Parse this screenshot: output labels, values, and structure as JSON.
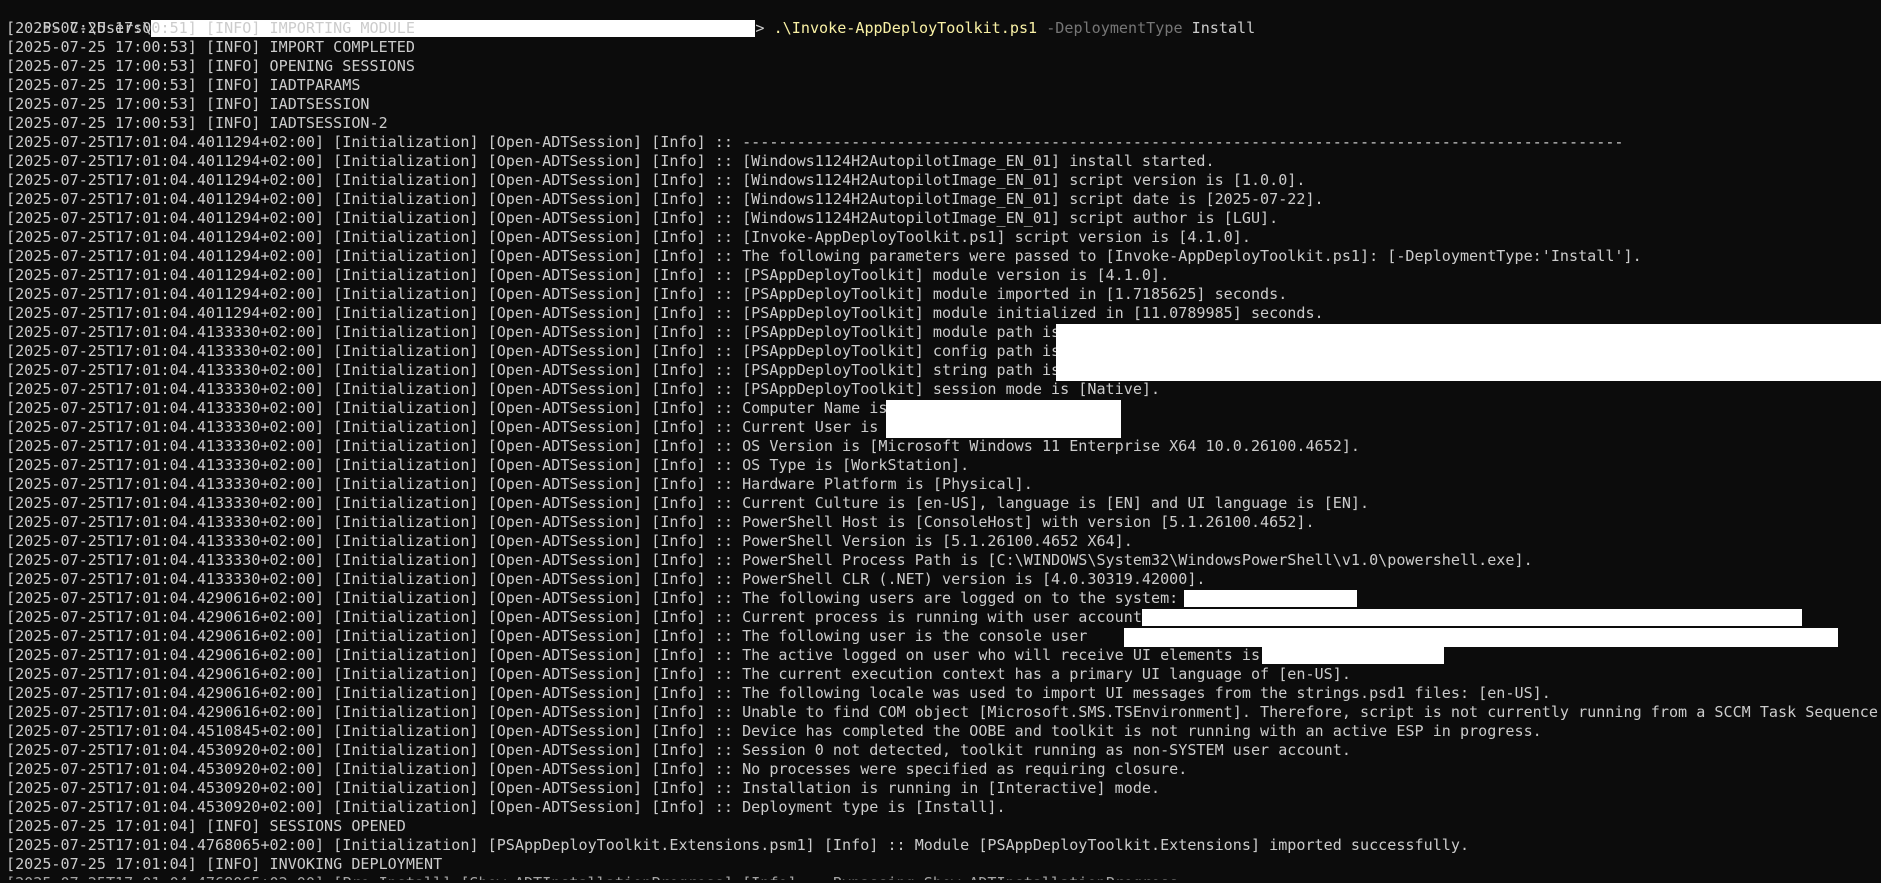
{
  "prompt": {
    "prefix": "PS C:\\Users\\",
    "suffix": "> ",
    "command": ".\\Invoke-AppDeployToolkit.ps1",
    "param": "-DeploymentType",
    "arg": "Install"
  },
  "lines": [
    "[2025-07-25 17:00:51] [INFO] IMPORTING MODULE",
    "[2025-07-25 17:00:53] [INFO] IMPORT COMPLETED",
    "[2025-07-25 17:00:53] [INFO] OPENING SESSIONS",
    "[2025-07-25 17:00:53] [INFO] IADTPARAMS",
    "[2025-07-25 17:00:53] [INFO] IADTSESSION",
    "[2025-07-25 17:00:53] [INFO] IADTSESSION-2",
    "[2025-07-25T17:01:04.4011294+02:00] [Initialization] [Open-ADTSession] [Info] :: -------------------------------------------------------------------------------------------------",
    "[2025-07-25T17:01:04.4011294+02:00] [Initialization] [Open-ADTSession] [Info] :: [Windows1124H2AutopilotImage_EN_01] install started.",
    "[2025-07-25T17:01:04.4011294+02:00] [Initialization] [Open-ADTSession] [Info] :: [Windows1124H2AutopilotImage_EN_01] script version is [1.0.0].",
    "[2025-07-25T17:01:04.4011294+02:00] [Initialization] [Open-ADTSession] [Info] :: [Windows1124H2AutopilotImage_EN_01] script date is [2025-07-22].",
    "[2025-07-25T17:01:04.4011294+02:00] [Initialization] [Open-ADTSession] [Info] :: [Windows1124H2AutopilotImage_EN_01] script author is [LGU].",
    "[2025-07-25T17:01:04.4011294+02:00] [Initialization] [Open-ADTSession] [Info] :: [Invoke-AppDeployToolkit.ps1] script version is [4.1.0].",
    "[2025-07-25T17:01:04.4011294+02:00] [Initialization] [Open-ADTSession] [Info] :: The following parameters were passed to [Invoke-AppDeployToolkit.ps1]: [-DeploymentType:'Install'].",
    "[2025-07-25T17:01:04.4011294+02:00] [Initialization] [Open-ADTSession] [Info] :: [PSAppDeployToolkit] module version is [4.1.0].",
    "[2025-07-25T17:01:04.4011294+02:00] [Initialization] [Open-ADTSession] [Info] :: [PSAppDeployToolkit] module imported in [1.7185625] seconds.",
    "[2025-07-25T17:01:04.4011294+02:00] [Initialization] [Open-ADTSession] [Info] :: [PSAppDeployToolkit] module initialized in [11.0789985] seconds.",
    "[2025-07-25T17:01:04.4133330+02:00] [Initialization] [Open-ADTSession] [Info] :: [PSAppDeployToolkit] module path is",
    "[2025-07-25T17:01:04.4133330+02:00] [Initialization] [Open-ADTSession] [Info] :: [PSAppDeployToolkit] config path is",
    "[2025-07-25T17:01:04.4133330+02:00] [Initialization] [Open-ADTSession] [Info] :: [PSAppDeployToolkit] string path is",
    "[2025-07-25T17:01:04.4133330+02:00] [Initialization] [Open-ADTSession] [Info] :: [PSAppDeployToolkit] session mode is [Native].",
    "[2025-07-25T17:01:04.4133330+02:00] [Initialization] [Open-ADTSession] [Info] :: Computer Name is",
    "[2025-07-25T17:01:04.4133330+02:00] [Initialization] [Open-ADTSession] [Info] :: Current User is",
    "[2025-07-25T17:01:04.4133330+02:00] [Initialization] [Open-ADTSession] [Info] :: OS Version is [Microsoft Windows 11 Enterprise X64 10.0.26100.4652].",
    "[2025-07-25T17:01:04.4133330+02:00] [Initialization] [Open-ADTSession] [Info] :: OS Type is [WorkStation].",
    "[2025-07-25T17:01:04.4133330+02:00] [Initialization] [Open-ADTSession] [Info] :: Hardware Platform is [Physical].",
    "[2025-07-25T17:01:04.4133330+02:00] [Initialization] [Open-ADTSession] [Info] :: Current Culture is [en-US], language is [EN] and UI language is [EN].",
    "[2025-07-25T17:01:04.4133330+02:00] [Initialization] [Open-ADTSession] [Info] :: PowerShell Host is [ConsoleHost] with version [5.1.26100.4652].",
    "[2025-07-25T17:01:04.4133330+02:00] [Initialization] [Open-ADTSession] [Info] :: PowerShell Version is [5.1.26100.4652 X64].",
    "[2025-07-25T17:01:04.4133330+02:00] [Initialization] [Open-ADTSession] [Info] :: PowerShell Process Path is [C:\\WINDOWS\\System32\\WindowsPowerShell\\v1.0\\powershell.exe].",
    "[2025-07-25T17:01:04.4133330+02:00] [Initialization] [Open-ADTSession] [Info] :: PowerShell CLR (.NET) version is [4.0.30319.42000].",
    "[2025-07-25T17:01:04.4290616+02:00] [Initialization] [Open-ADTSession] [Info] :: The following users are logged on to the system:",
    "[2025-07-25T17:01:04.4290616+02:00] [Initialization] [Open-ADTSession] [Info] :: Current process is running with user account",
    "[2025-07-25T17:01:04.4290616+02:00] [Initialization] [Open-ADTSession] [Info] :: The following user is the console user",
    "[2025-07-25T17:01:04.4290616+02:00] [Initialization] [Open-ADTSession] [Info] :: The active logged on user who will receive UI elements is",
    "[2025-07-25T17:01:04.4290616+02:00] [Initialization] [Open-ADTSession] [Info] :: The current execution context has a primary UI language of [en-US].",
    "[2025-07-25T17:01:04.4290616+02:00] [Initialization] [Open-ADTSession] [Info] :: The following locale was used to import UI messages from the strings.psd1 files: [en-US].",
    "[2025-07-25T17:01:04.4290616+02:00] [Initialization] [Open-ADTSession] [Info] :: Unable to find COM object [Microsoft.SMS.TSEnvironment]. Therefore, script is not currently running from a SCCM Task Sequence.",
    "[2025-07-25T17:01:04.4510845+02:00] [Initialization] [Open-ADTSession] [Info] :: Device has completed the OOBE and toolkit is not running with an active ESP in progress.",
    "[2025-07-25T17:01:04.4530920+02:00] [Initialization] [Open-ADTSession] [Info] :: Session 0 not detected, toolkit running as non-SYSTEM user account.",
    "[2025-07-25T17:01:04.4530920+02:00] [Initialization] [Open-ADTSession] [Info] :: No processes were specified as requiring closure.",
    "[2025-07-25T17:01:04.4530920+02:00] [Initialization] [Open-ADTSession] [Info] :: Installation is running in [Interactive] mode.",
    "[2025-07-25T17:01:04.4530920+02:00] [Initialization] [Open-ADTSession] [Info] :: Deployment type is [Install].",
    "[2025-07-25 17:01:04] [INFO] SESSIONS OPENED",
    "[2025-07-25T17:01:04.4768065+02:00] [Initialization] [PSAppDeployToolkit.Extensions.psm1] [Info] :: Module [PSAppDeployToolkit.Extensions] imported successfully.",
    "[2025-07-25 17:01:04] [INFO] INVOKING DEPLOYMENT"
  ]
}
